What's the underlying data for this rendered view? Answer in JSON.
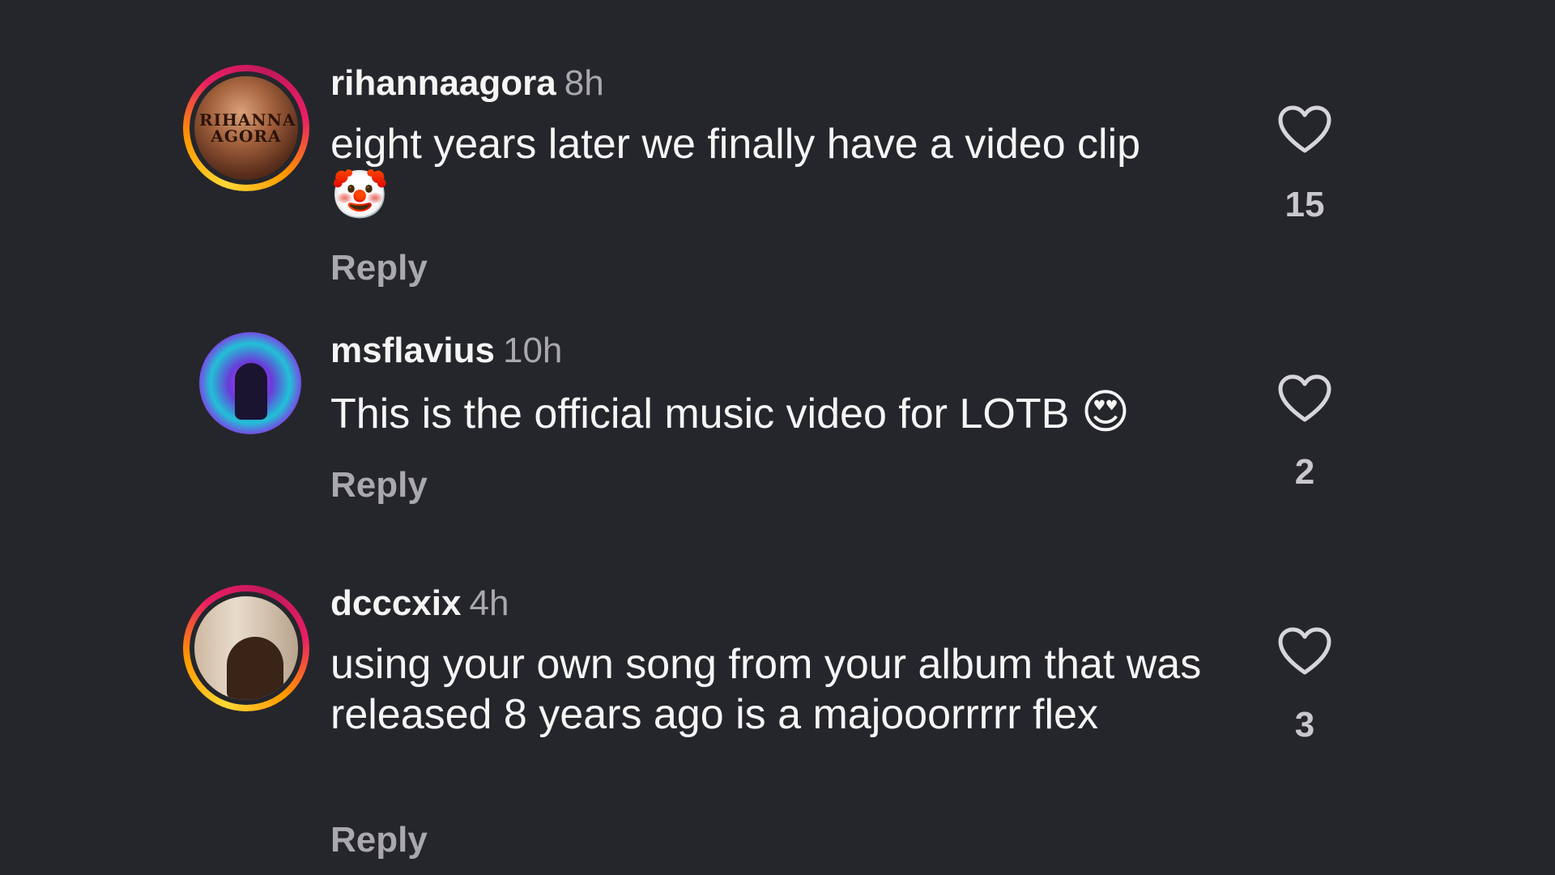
{
  "comments": [
    {
      "username": "rihannaagora",
      "time": "8h",
      "text": "eight years later we finally have a video clip",
      "emoji": "🤡",
      "reply_label": "Reply",
      "likes": "15",
      "avatar_text": "RIHANNA AGORA",
      "avatar_ring": true
    },
    {
      "username": "msflavius",
      "time": "10h",
      "text": "This is the official music video for LOTB",
      "emoji": "😍",
      "reply_label": "Reply",
      "likes": "2",
      "avatar_ring": false
    },
    {
      "username": "dcccxix",
      "time": "4h",
      "text": "using your own song from your album that was released 8 years ago is a majooorrrrr flex",
      "reply_label": "Reply",
      "likes": "3",
      "avatar_ring": true
    }
  ],
  "icons": {
    "like": "heart-icon"
  },
  "colors": {
    "background": "#25262b",
    "secondary_text": "#a8a8ad",
    "story_ring_start": "#fdd835",
    "story_ring_end": "#e91e63"
  }
}
